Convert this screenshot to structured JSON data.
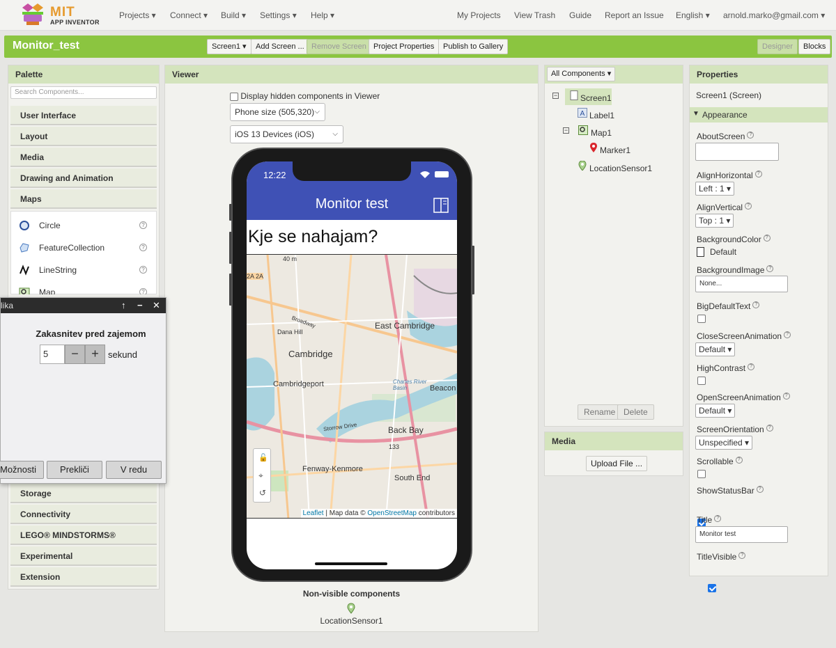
{
  "topnav": {
    "brand": "MIT",
    "brand_sub": "APP INVENTOR",
    "menus": [
      "Projects ▾",
      "Connect ▾",
      "Build ▾",
      "Settings ▾",
      "Help ▾"
    ],
    "right_links": [
      "My Projects",
      "View Trash",
      "Guide",
      "Report an Issue",
      "English ▾",
      "arnold.marko@gmail.com ▾"
    ]
  },
  "toolbar": {
    "project_name": "Monitor_test",
    "screen_select": "Screen1 ▾",
    "add_screen": "Add Screen ...",
    "remove_screen": "Remove Screen",
    "project_properties": "Project Properties",
    "publish": "Publish to Gallery",
    "designer": "Designer",
    "blocks": "Blocks"
  },
  "palette": {
    "title": "Palette",
    "search_placeholder": "Search Components...",
    "categories_top": [
      "User Interface",
      "Layout",
      "Media",
      "Drawing and Animation",
      "Maps"
    ],
    "map_items": [
      {
        "label": "Circle",
        "icon": "circle-icon"
      },
      {
        "label": "FeatureCollection",
        "icon": "feature-collection-icon"
      },
      {
        "label": "LineString",
        "icon": "linestring-icon"
      },
      {
        "label": "Map",
        "icon": "map-icon"
      }
    ],
    "categories_bottom": [
      "Storage",
      "Connectivity",
      "LEGO® MINDSTORMS®",
      "Experimental",
      "Extension"
    ]
  },
  "viewer": {
    "title": "Viewer",
    "hidden_checkbox": "Display hidden components in Viewer",
    "phone_size": "Phone size (505,320)",
    "device": "iOS 13 Devices (iOS)",
    "status_time": "12:22",
    "app_title": "Monitor test",
    "label_text": "Kje se nahajam?",
    "map_labels": {
      "east_cambridge": "East Cambridge",
      "cambridge": "Cambridge",
      "cambridgeport": "Cambridgeport",
      "back_bay": "Back Bay",
      "fenway": "Fenway-Kenmore",
      "south_end": "South End",
      "beacon": "Beacon",
      "dana_hill": "Dana Hill",
      "broadway": "Broadway",
      "charles": "Charles River Basin",
      "storrow": "Storrow Drive",
      "route_2a": "2A 2A",
      "forty_m": "40 m",
      "num_133": "133"
    },
    "attribution": {
      "leaflet": "Leaflet",
      "mid": " | Map data © ",
      "osm": "OpenStreetMap",
      "end": " contributors"
    },
    "nonvisible_title": "Non-visible components",
    "nonvisible_item": "LocationSensor1"
  },
  "components": {
    "filter": "All Components ▾",
    "tree": [
      "Screen1",
      "Label1",
      "Map1",
      "Marker1",
      "LocationSensor1"
    ],
    "rename": "Rename",
    "delete": "Delete"
  },
  "media": {
    "title": "Media",
    "upload": "Upload File ..."
  },
  "properties": {
    "title": "Properties",
    "subject": "Screen1 (Screen)",
    "section": "Appearance",
    "about_screen": "AboutScreen",
    "align_h": "AlignHorizontal",
    "align_h_value": "Left : 1 ▾",
    "align_v": "AlignVertical",
    "align_v_value": "Top : 1 ▾",
    "bg_color": "BackgroundColor",
    "bg_color_value": "Default",
    "bg_image": "BackgroundImage",
    "bg_image_value": "None...",
    "big_default": "BigDefaultText",
    "close_anim": "CloseScreenAnimation",
    "close_anim_value": "Default ▾",
    "high_contrast": "HighContrast",
    "open_anim": "OpenScreenAnimation",
    "open_anim_value": "Default ▾",
    "orientation": "ScreenOrientation",
    "orientation_value": "Unspecified ▾",
    "scrollable": "Scrollable",
    "show_status": "ShowStatusBar",
    "title_prop": "Title",
    "title_value": "Monitor test",
    "title_visible": "TitleVisible"
  },
  "dialog": {
    "title": "lika",
    "heading": "Zakasnitev pred zajemom",
    "value": "5",
    "unit": "sekund",
    "options_btn": "Možnosti",
    "cancel_btn": "Prekliči",
    "ok_btn": "V redu"
  },
  "colors": {
    "accent_green": "#8bc540",
    "panel_header": "#d4e4bd",
    "app_bar": "#3f51b5"
  }
}
